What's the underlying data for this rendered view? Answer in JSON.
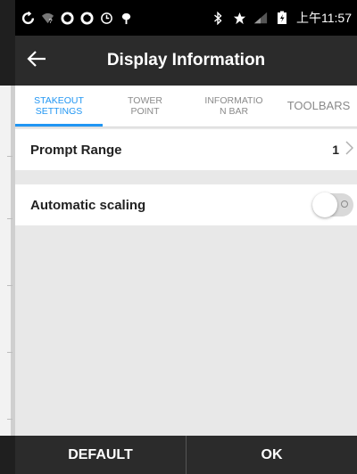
{
  "status_bar": {
    "left_icons": [
      "sync-icon",
      "wifi-question-icon",
      "sync-icon",
      "sync-icon",
      "clock-icon",
      "antenna-icon"
    ],
    "right_icons": [
      "bluetooth-icon",
      "star-icon",
      "signal-icon",
      "battery-icon"
    ],
    "time": "上午11:57"
  },
  "app_bar": {
    "title": "Display Information",
    "back_icon": "arrow-left-icon"
  },
  "tabs": [
    {
      "label": "STAKEOUT\nSETTINGS",
      "active": true
    },
    {
      "label": "TOWER\nPOINT",
      "active": false
    },
    {
      "label": "INFORMATIO\nN BAR",
      "active": false
    },
    {
      "label": "TOOLBARS",
      "active": false
    }
  ],
  "settings": {
    "prompt_range": {
      "label": "Prompt Range",
      "value": "1"
    },
    "automatic_scaling": {
      "label": "Automatic scaling",
      "enabled": false
    }
  },
  "bottom_bar": {
    "default_label": "DEFAULT",
    "ok_label": "OK"
  },
  "colors": {
    "accent": "#2196f3",
    "app_bar": "#2b2b2b",
    "status_bar": "#000000"
  }
}
